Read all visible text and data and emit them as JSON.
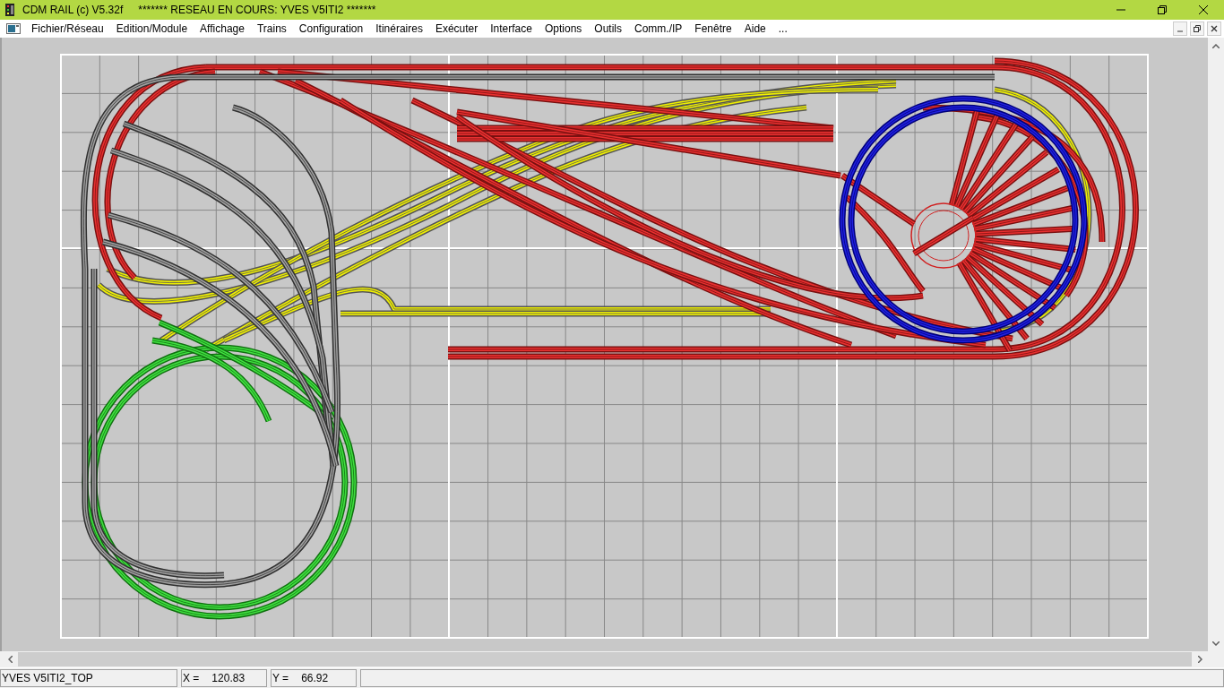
{
  "window": {
    "app_title": "CDM RAIL (c) V5.32f",
    "network_title": "******* RESEAU EN COURS: YVES V5ITI2 *******"
  },
  "menu": {
    "items": [
      "Fichier/Réseau",
      "Edition/Module",
      "Affichage",
      "Trains",
      "Configuration",
      "Itinéraires",
      "Exécuter",
      "Interface",
      "Options",
      "Outils",
      "Comm./IP",
      "Fenêtre",
      "Aide",
      "..."
    ]
  },
  "status_bar": {
    "network": "YVES V5ITI2_TOP",
    "x_label": "X =",
    "x_value": "120.83",
    "y_label": "Y =",
    "y_value": "66.92"
  }
}
